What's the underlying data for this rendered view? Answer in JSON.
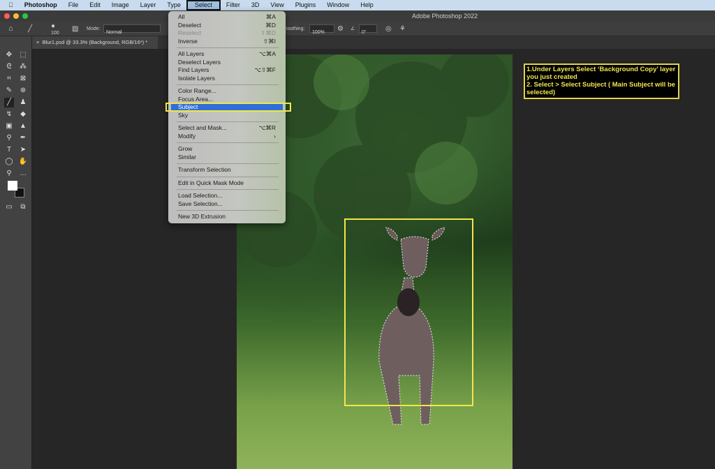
{
  "menubar": {
    "app": "Photoshop",
    "items": [
      "File",
      "Edit",
      "Image",
      "Layer",
      "Type",
      "Select",
      "Filter",
      "3D",
      "View",
      "Plugins",
      "Window",
      "Help"
    ]
  },
  "window": {
    "title": "Adobe Photoshop 2022"
  },
  "options": {
    "brush_size": "100",
    "mode_label": "Mode:",
    "mode_value": "Normal",
    "smoothing_label": "Smoothing:",
    "smoothing_value": "100%",
    "angle_value": "0°"
  },
  "document_tab": {
    "label": "Blur1.psd @ 33.3% (Background, RGB/16*) *"
  },
  "select_menu": {
    "groups": [
      [
        {
          "label": "All",
          "shortcut": "⌘A"
        },
        {
          "label": "Deselect",
          "shortcut": "⌘D"
        },
        {
          "label": "Reselect",
          "shortcut": "⇧⌘D",
          "disabled": true
        },
        {
          "label": "Inverse",
          "shortcut": "⇧⌘I"
        }
      ],
      [
        {
          "label": "All Layers",
          "shortcut": "⌥⌘A"
        },
        {
          "label": "Deselect Layers",
          "shortcut": ""
        },
        {
          "label": "Find Layers",
          "shortcut": "⌥⇧⌘F"
        },
        {
          "label": "Isolate Layers",
          "shortcut": ""
        }
      ],
      [
        {
          "label": "Color Range...",
          "shortcut": ""
        },
        {
          "label": "Focus Area...",
          "shortcut": ""
        },
        {
          "label": "Subject",
          "shortcut": "",
          "highlighted": true
        },
        {
          "label": "Sky",
          "shortcut": ""
        }
      ],
      [
        {
          "label": "Select and Mask...",
          "shortcut": "⌥⌘R"
        },
        {
          "label": "Modify",
          "shortcut": "›"
        }
      ],
      [
        {
          "label": "Grow",
          "shortcut": ""
        },
        {
          "label": "Similar",
          "shortcut": ""
        }
      ],
      [
        {
          "label": "Transform Selection",
          "shortcut": ""
        }
      ],
      [
        {
          "label": "Edit in Quick Mask Mode",
          "shortcut": ""
        }
      ],
      [
        {
          "label": "Load Selection...",
          "shortcut": ""
        },
        {
          "label": "Save Selection...",
          "shortcut": ""
        }
      ],
      [
        {
          "label": "New 3D Extrusion",
          "shortcut": ""
        }
      ]
    ]
  },
  "annotation": {
    "line1": "1.Under Layers Select ‘Background Copy’ layer you just created",
    "line2": "2. Select > Select Subject ( Main Subject will be selected)"
  },
  "colors": {
    "highlight": "#2f6fd8",
    "annotation": "#f2e64a"
  }
}
